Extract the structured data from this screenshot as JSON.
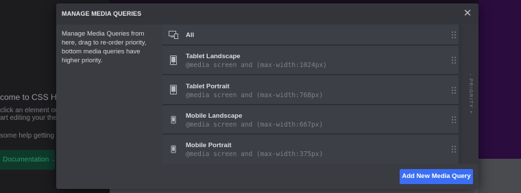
{
  "background": {
    "welcome_heading": "come to CSS Hero",
    "hint_line1": "click an  element  on",
    "hint_line2": "art editing your theme",
    "help_text": "some help getting sta",
    "doc_button": "Documentation →"
  },
  "dialog": {
    "title": "MANAGE MEDIA QUERIES",
    "close_glyph": "✕",
    "description": "Manage Media Queries from here, drag to re-order priority, bottom media queries have higher priority.",
    "priority_label": "- PRIORITY +",
    "add_button": "Add New Media Query"
  },
  "media_queries": [
    {
      "name": "All",
      "query": "",
      "icon": "desktop-laptop-icon"
    },
    {
      "name": "Tablet Landscape",
      "query": "@media screen and (max-width:1024px)",
      "icon": "tablet-icon"
    },
    {
      "name": "Tablet Portrait",
      "query": "@media screen and (max-width:768px)",
      "icon": "tablet-icon"
    },
    {
      "name": "Mobile Landscape",
      "query": "@media screen and (max-width:667px)",
      "icon": "mobile-icon"
    },
    {
      "name": "Mobile Portrait",
      "query": "@media screen and (max-width:375px)",
      "icon": "mobile-icon"
    }
  ],
  "colors": {
    "accent": "#3b6ef2",
    "dialog_bg": "#3a3c42",
    "item_bg": "#3c3f45",
    "purple_backdrop": "#2b0c3f"
  }
}
